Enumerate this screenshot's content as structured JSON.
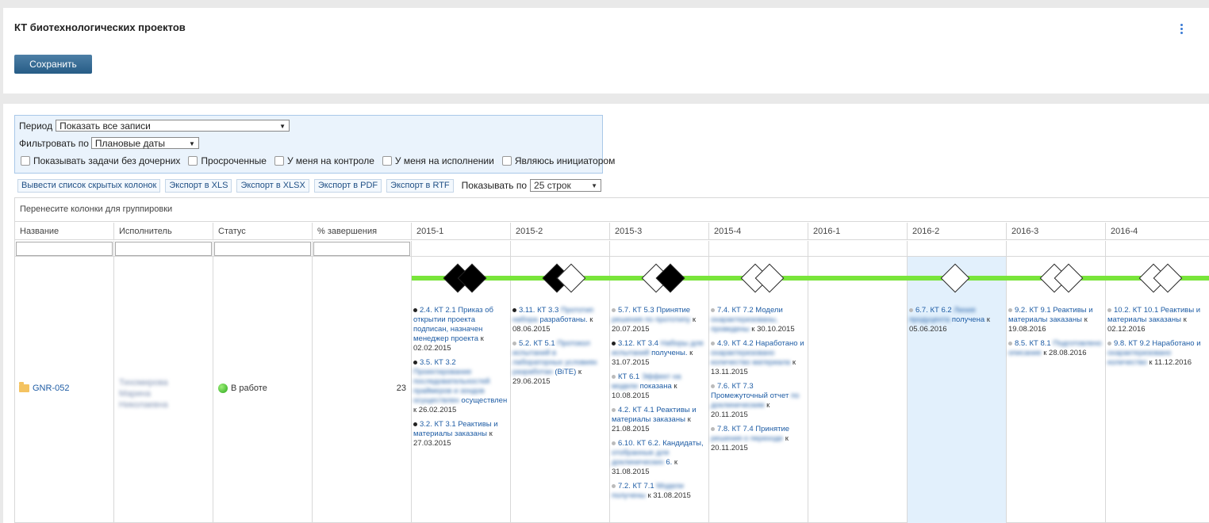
{
  "header": {
    "title": "КТ биотехнологических проектов",
    "save_label": "Сохранить",
    "menu_icon": "kebab-vertical-icon"
  },
  "filters": {
    "period_label": "Период",
    "period_value": "Показать все записи",
    "filter_by_label": "Фильтровать по",
    "filter_by_value": "Плановые даты",
    "checkboxes": [
      "Показывать задачи без дочерних",
      "Просроченные",
      "У меня на контроле",
      "У меня на исполнении",
      "Являюсь инициатором"
    ]
  },
  "toolbar": {
    "hidden_cols": "Вывести список скрытых колонок",
    "export_xls": "Экспорт в XLS",
    "export_xlsx": "Экспорт в XLSX",
    "export_pdf": "Экспорт в PDF",
    "export_rtf": "Экспорт в RTF",
    "show_by_label": "Показывать по",
    "rows_value": "25 строк"
  },
  "grid": {
    "group_hint": "Перенесите колонки для группировки",
    "columns": [
      "Название",
      "Исполнитель",
      "Статус",
      "% завершения",
      "2015-1",
      "2015-2",
      "2015-3",
      "2015-4",
      "2016-1",
      "2016-2",
      "2016-3",
      "2016-4"
    ],
    "row": {
      "name": "GNR-052",
      "executor": "Тихомирова Марина Николаевна",
      "status": "В работе",
      "percent": "23"
    },
    "tasks": {
      "q2015_1": [
        {
          "title": "2.4. КТ 2.1 Приказ об открытии проекта подписан, назначен менеджер проекта",
          "date": "к 02.02.2015"
        },
        {
          "title": "3.5. КТ 3.2",
          "blur": "Проектирование последовательностей праймеров и зондов осуществлен",
          "mid": "осуществлен",
          "date": "к 26.02.2015"
        },
        {
          "title": "3.2. КТ 3.1 Реактивы и материалы заказаны",
          "date": "к 27.03.2015"
        }
      ],
      "q2015_2": [
        {
          "title": "3.11. КТ 3.3",
          "blur": "Прототип набора",
          "mid": "разработаны.",
          "date": "к 08.06.2015"
        },
        {
          "title": "5.2. КТ 5.1",
          "blur": "Протокол испытаний в лабораторных условиях разработан",
          "mid": "(BiTE)",
          "date": "к 29.06.2015"
        }
      ],
      "q2015_3": [
        {
          "title": "5.7. КТ 5.3 Принятие",
          "blur": "решения по прототипу",
          "date": "к 20.07.2015"
        },
        {
          "title": "3.12. КТ 3.4",
          "blur": "Наборы для испытаний",
          "mid": "получены.",
          "date": "к 31.07.2015"
        },
        {
          "title": "КТ 6.1",
          "blur": "Эффект на модели",
          "mid": "показана",
          "date": "к 10.08.2015"
        },
        {
          "title": "4.2. КТ 4.1 Реактивы и материалы заказаны",
          "date": "к 21.08.2015"
        },
        {
          "title": "6.10. КТ 6.2. Кандидаты,",
          "blur": "отобранные для доклинических",
          "mid": "6.",
          "date": "к 31.08.2015"
        },
        {
          "title": "7.2. КТ 7.1",
          "blur": "Модели получены",
          "date": "к 31.08.2015"
        }
      ],
      "q2015_4": [
        {
          "title": "7.4. КТ 7.2 Модели",
          "blur": "охарактеризованы, проведены",
          "date": "к 30.10.2015"
        },
        {
          "title": "4.9. КТ 4.2 Наработано и",
          "blur": "охарактеризовано количество материала",
          "date": "к 13.11.2015"
        },
        {
          "title": "7.6. КТ 7.3",
          "mid": "Промежуточный отчет",
          "blur": "по доклиническим",
          "date": "к 20.11.2015"
        },
        {
          "title": "7.8. КТ 7.4 Принятие",
          "blur": "решения о переходе",
          "date": "к 20.11.2015"
        }
      ],
      "q2016_2": [
        {
          "title": "6.7. КТ 6.2",
          "blur": "Линия продуцента",
          "mid": "получена",
          "date": "к 05.06.2016"
        }
      ],
      "q2016_3": [
        {
          "title": "9.2. КТ 9.1 Реактивы и материалы заказаны",
          "date": "к 19.08.2016"
        },
        {
          "title": "8.5. КТ 8.1",
          "blur": "Подготовлено описание",
          "date": "к 28.08.2016"
        }
      ],
      "q2016_4": [
        {
          "title": "10.2. КТ 10.1 Реактивы и материалы заказаны",
          "date": "к 02.12.2016"
        },
        {
          "title": "9.8. КТ 9.2 Наработано и",
          "blur": "охарактеризовано количество",
          "date": "к 11.12.2016"
        }
      ]
    }
  },
  "colors": {
    "accent": "#265c86",
    "timeline": "#79e53a",
    "highlight": "#e2f0fc",
    "link": "#1f5da5"
  }
}
